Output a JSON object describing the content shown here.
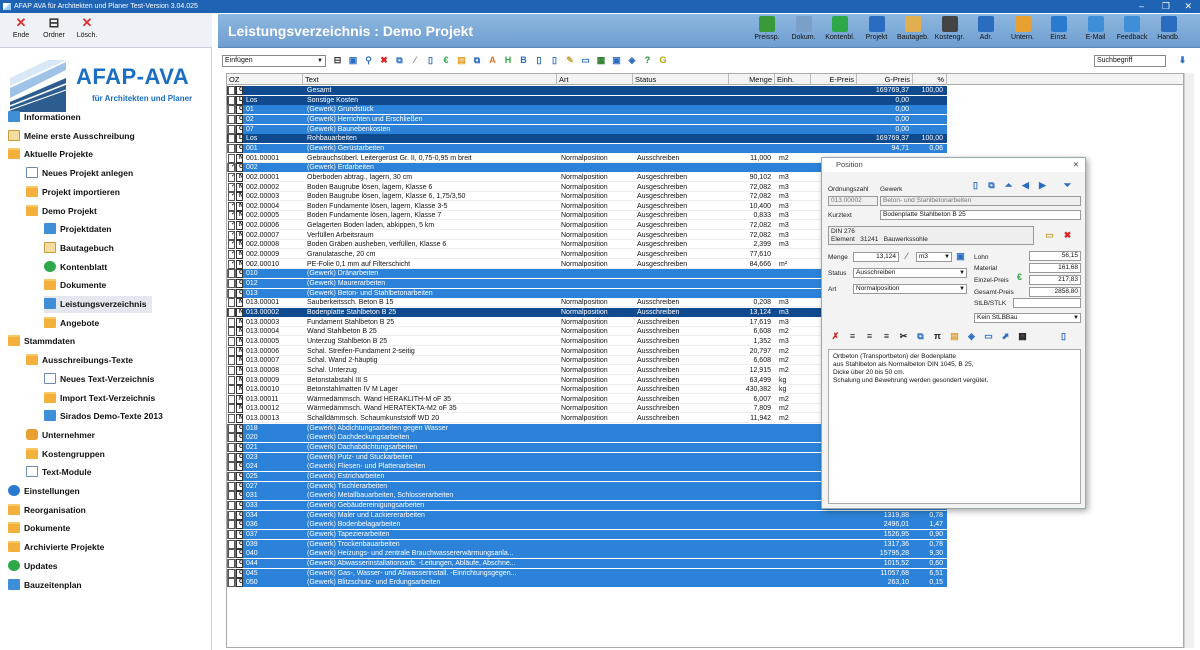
{
  "window": {
    "title": "AFAP AVA für Architekten und Planer Test-Version 3.04.025"
  },
  "left_toolbar": [
    {
      "label": "Ende",
      "icon": "close-icon",
      "color": "#d33"
    },
    {
      "label": "Ordner",
      "icon": "tree-icon",
      "color": "#333"
    },
    {
      "label": "Lösch.",
      "icon": "delete-icon",
      "color": "#d33"
    }
  ],
  "brand": {
    "name": "AFAP-AVA",
    "tagline": "für Architekten und Planer"
  },
  "nav": [
    {
      "label": "Informationen",
      "icon": "blue",
      "level": 0
    },
    {
      "label": "Meine erste Ausschreibung",
      "icon": "book",
      "level": 0
    },
    {
      "label": "Aktuelle Projekte",
      "icon": "folder",
      "level": 0
    },
    {
      "label": "Neues Projekt anlegen",
      "icon": "doc",
      "level": 1
    },
    {
      "label": "Projekt importieren",
      "icon": "folder",
      "level": 1
    },
    {
      "label": "Demo Projekt",
      "icon": "folder",
      "level": 1
    },
    {
      "label": "Projektdaten",
      "icon": "blue",
      "level": 2
    },
    {
      "label": "Bautagebuch",
      "icon": "book",
      "level": 2
    },
    {
      "label": "Kontenblatt",
      "icon": "green",
      "level": 2
    },
    {
      "label": "Dokumente",
      "icon": "folder",
      "level": 2
    },
    {
      "label": "Leistungsverzeichnis",
      "icon": "blue",
      "level": 2,
      "selected": true
    },
    {
      "label": "Angebote",
      "icon": "folder",
      "level": 2
    },
    {
      "label": "Stammdaten",
      "icon": "folder",
      "level": 0
    },
    {
      "label": "Ausschreibungs-Texte",
      "icon": "folder",
      "level": 1
    },
    {
      "label": "Neues Text-Verzeichnis",
      "icon": "doc",
      "level": 2
    },
    {
      "label": "Import Text-Verzeichnis",
      "icon": "folder",
      "level": 2
    },
    {
      "label": "Sirados Demo-Texte 2013",
      "icon": "blue",
      "level": 2
    },
    {
      "label": "Unternehmer",
      "icon": "hand",
      "level": 1
    },
    {
      "label": "Kostengruppen",
      "icon": "folder",
      "level": 1
    },
    {
      "label": "Text-Module",
      "icon": "doc",
      "level": 1
    },
    {
      "label": "Einstellungen",
      "icon": "gear",
      "level": 0
    },
    {
      "label": "Reorganisation",
      "icon": "folder",
      "level": 0
    },
    {
      "label": "Dokumente",
      "icon": "folder",
      "level": 0
    },
    {
      "label": "Archivierte Projekte",
      "icon": "folder",
      "level": 0
    },
    {
      "label": "Updates",
      "icon": "green",
      "level": 0
    },
    {
      "label": "Bauzeitenplan",
      "icon": "blue",
      "level": 0
    }
  ],
  "header": {
    "title": "Leistungsverzeichnis : Demo Projekt",
    "buttons": [
      {
        "label": "Preissp.",
        "icon": "chart-icon",
        "color": "#3a9a3a"
      },
      {
        "label": "Dokum.",
        "icon": "document-icon",
        "color": "#7aa0c8"
      },
      {
        "label": "Kontenbl.",
        "icon": "euro-icon",
        "color": "#2fa84a"
      },
      {
        "label": "Projekt",
        "icon": "building-icon",
        "color": "#2a6cc0"
      },
      {
        "label": "Bautageb.",
        "icon": "book-icon",
        "color": "#e0b050"
      },
      {
        "label": "Kostengr.",
        "icon": "tree-icon",
        "color": "#444"
      },
      {
        "label": "Adr.",
        "icon": "mail-icon",
        "color": "#2a6cc0"
      },
      {
        "label": "Untern.",
        "icon": "hand-icon",
        "color": "#e8a030"
      },
      {
        "label": "Einst.",
        "icon": "gear-icon",
        "color": "#2a7ad0"
      },
      {
        "label": "E-Mail",
        "icon": "email-icon",
        "color": "#3f8fd8"
      },
      {
        "label": "Feedback",
        "icon": "feedback-icon",
        "color": "#3f8fd8"
      },
      {
        "label": "Handb.",
        "icon": "manual-icon",
        "color": "#2a6cc0"
      }
    ]
  },
  "toolbar": {
    "insert_value": "Einfügen",
    "search_placeholder": "Suchbegriff"
  },
  "grid": {
    "columns": [
      "OZ",
      "Text",
      "Art",
      "Status",
      "Menge",
      "Einh.",
      "E-Preis",
      "G-Preis",
      "%"
    ],
    "rows": [
      {
        "t": "l",
        "tag": "G",
        "oz": "",
        "text": "Gesamt",
        "gp": "169769,37",
        "pct": "100,00"
      },
      {
        "t": "l",
        "tag": "L",
        "oz": "Los",
        "text": "Sonstige Kosten",
        "gp": "0,00"
      },
      {
        "t": "g",
        "tag": "G",
        "oz": "01",
        "text": "(Gewerk) Grundstück",
        "gp": "0,00"
      },
      {
        "t": "g",
        "tag": "G",
        "oz": "02",
        "text": "(Gewerk) Herrichten und Erschließen",
        "gp": "0,00"
      },
      {
        "t": "g",
        "tag": "G",
        "oz": "07",
        "text": "(Gewerk) Baunebenkosten",
        "gp": "0,00"
      },
      {
        "t": "l",
        "tag": "L",
        "oz": "Los",
        "text": "Rohbauarbeiten",
        "gp": "169769,37",
        "pct": "100,00"
      },
      {
        "t": "g",
        "tag": "G",
        "oz": "001",
        "text": "(Gewerk) Gerüstarbeiten",
        "gp": "94,71",
        "pct": "0,06"
      },
      {
        "t": "n",
        "tag": "N",
        "oz": "001.00001",
        "text": "Gebrauchsüberl. Leitergerüst Gr. II, 0,75-0,95 m breit",
        "art": "Normalposition",
        "st": "Ausschreiben",
        "m": "11,000",
        "e": "m2"
      },
      {
        "t": "g",
        "tag": "G",
        "chk": true,
        "oz": "002",
        "text": "(Gewerk) Erdarbeiten"
      },
      {
        "t": "n",
        "tag": "N",
        "chk": true,
        "oz": "002.00001",
        "text": "Oberboden abtrag., lagern, 30 cm",
        "art": "Normalposition",
        "st": "Ausgeschreiben",
        "m": "90,102",
        "e": "m3"
      },
      {
        "t": "n",
        "tag": "N",
        "chk": true,
        "oz": "002.00002",
        "text": "Boden Baugrube lösen, lagern, Klasse 6",
        "art": "Normalposition",
        "st": "Ausgeschreiben",
        "m": "72,082",
        "e": "m3"
      },
      {
        "t": "n",
        "tag": "N",
        "chk": true,
        "oz": "002.00003",
        "text": "Boden Baugrube lösen, lagern, Klasse 6, 1,75/3,50",
        "art": "Normalposition",
        "st": "Ausgeschreiben",
        "m": "72,082",
        "e": "m3"
      },
      {
        "t": "n",
        "tag": "N",
        "chk": true,
        "oz": "002.00004",
        "text": "Boden Fundamente lösen, lagern, Klasse 3-5",
        "art": "Normalposition",
        "st": "Ausgeschreiben",
        "m": "10,400",
        "e": "m3"
      },
      {
        "t": "n",
        "tag": "N",
        "chk": true,
        "oz": "002.00005",
        "text": "Boden Fundamente lösen, lagern, Klasse 7",
        "art": "Normalposition",
        "st": "Ausgeschreiben",
        "m": "0,833",
        "e": "m3"
      },
      {
        "t": "n",
        "tag": "N",
        "chk": true,
        "oz": "002.00006",
        "text": "Gelagerten Boden laden, abkippen, 5 km",
        "art": "Normalposition",
        "st": "Ausgeschreiben",
        "m": "72,082",
        "e": "m3"
      },
      {
        "t": "n",
        "tag": "N",
        "chk": true,
        "oz": "002.00007",
        "text": "Verfüllen Arbeitsraum",
        "art": "Normalposition",
        "st": "Ausgeschreiben",
        "m": "72,082",
        "e": "m3"
      },
      {
        "t": "n",
        "tag": "N",
        "chk": true,
        "oz": "002.00008",
        "text": "Boden Gräben ausheben, verfüllen, Klasse 6",
        "art": "Normalposition",
        "st": "Ausgeschreiben",
        "m": "2,399",
        "e": "m3"
      },
      {
        "t": "n",
        "tag": "N",
        "chk": true,
        "oz": "002.00009",
        "text": "Granulatasche, 20 cm",
        "art": "Normalposition",
        "st": "Ausgeschreiben",
        "m": "77,610",
        "e": ""
      },
      {
        "t": "n",
        "tag": "N",
        "chk": true,
        "oz": "002.00010",
        "text": "PE-Folie 0,1 mm auf Filterschicht",
        "art": "Normalposition",
        "st": "Ausgeschreiben",
        "m": "84,666",
        "e": "m²"
      },
      {
        "t": "g",
        "tag": "G",
        "oz": "010",
        "text": "(Gewerk) Dränarbeiten"
      },
      {
        "t": "g",
        "tag": "G",
        "oz": "012",
        "text": "(Gewerk) Maurerarbeiten"
      },
      {
        "t": "g",
        "tag": "G",
        "oz": "013",
        "text": "(Gewerk) Beton- und Stahlbetonarbeiten"
      },
      {
        "t": "n",
        "tag": "N",
        "oz": "013.00001",
        "text": "Sauberkeitssch. Beton B 15",
        "art": "Normalposition",
        "st": "Ausschreiben",
        "m": "0,208",
        "e": "m3"
      },
      {
        "t": "sel",
        "tag": "N",
        "oz": "013.00002",
        "text": "Bodenplatte Stahlbeton B 25",
        "art": "Normalposition",
        "st": "Ausschreiben",
        "m": "13,124",
        "e": "m3"
      },
      {
        "t": "n",
        "tag": "N",
        "oz": "013.00003",
        "text": "Fundament Stahlbeton B 25",
        "art": "Normalposition",
        "st": "Ausschreiben",
        "m": "17,619",
        "e": "m3"
      },
      {
        "t": "n",
        "tag": "N",
        "oz": "013.00004",
        "text": "Wand Stahlbeton B 25",
        "art": "Normalposition",
        "st": "Ausschreiben",
        "m": "6,608",
        "e": "m2"
      },
      {
        "t": "n",
        "tag": "N",
        "oz": "013.00005",
        "text": "Unterzug Stahlbeton B 25",
        "art": "Normalposition",
        "st": "Ausschreiben",
        "m": "1,352",
        "e": "m3"
      },
      {
        "t": "n",
        "tag": "N",
        "oz": "013.00006",
        "text": "Schal. Streifen-Fundament 2-seitig",
        "art": "Normalposition",
        "st": "Ausschreiben",
        "m": "20,797",
        "e": "m2"
      },
      {
        "t": "n",
        "tag": "N",
        "oz": "013.00007",
        "text": "Schal. Wand 2-häuptig",
        "art": "Normalposition",
        "st": "Ausschreiben",
        "m": "6,608",
        "e": "m2"
      },
      {
        "t": "n",
        "tag": "N",
        "oz": "013.00008",
        "text": "Schal. Unterzug",
        "art": "Normalposition",
        "st": "Ausschreiben",
        "m": "12,915",
        "e": "m2"
      },
      {
        "t": "n",
        "tag": "N",
        "oz": "013.00009",
        "text": "Betonstabstahl III S",
        "art": "Normalposition",
        "st": "Ausschreiben",
        "m": "63,499",
        "e": "kg"
      },
      {
        "t": "n",
        "tag": "N",
        "oz": "013.00010",
        "text": "Betonstahlmatten IV M Lager",
        "art": "Normalposition",
        "st": "Ausschreiben",
        "m": "430,382",
        "e": "kg"
      },
      {
        "t": "n",
        "tag": "N",
        "oz": "013.00011",
        "text": "Wärmedämmsch. Wand HERAKLITH-M oF 35",
        "art": "Normalposition",
        "st": "Ausschreiben",
        "m": "6,007",
        "e": "m2"
      },
      {
        "t": "n",
        "tag": "N",
        "oz": "013.00012",
        "text": "Wärmedämmsch. Wand HERATEKTA-M2 oF 35",
        "art": "Normalposition",
        "st": "Ausschreiben",
        "m": "7,809",
        "e": "m2"
      },
      {
        "t": "n",
        "tag": "N",
        "oz": "013.00013",
        "text": "Schalldämmsch. Schaumkunststoff WD 20",
        "art": "Normalposition",
        "st": "Ausschreiben",
        "m": "11,942",
        "e": "m2"
      },
      {
        "t": "g",
        "tag": "G",
        "oz": "018",
        "text": "(Gewerk) Abdichtungsarbeiten gegen Wasser"
      },
      {
        "t": "g",
        "tag": "G",
        "oz": "020",
        "text": "(Gewerk) Dachdeckungsarbeiten"
      },
      {
        "t": "g",
        "tag": "G",
        "oz": "021",
        "text": "(Gewerk) Dachabdichtungsarbeiten"
      },
      {
        "t": "g",
        "tag": "G",
        "oz": "023",
        "text": "(Gewerk) Putz- und Stuckarbeiten"
      },
      {
        "t": "g",
        "tag": "G",
        "oz": "024",
        "text": "(Gewerk) Fliesen- und Plattenarbeiten"
      },
      {
        "t": "g",
        "tag": "G",
        "oz": "025",
        "text": "(Gewerk) Estricharbeiten",
        "gp": "7364,76",
        "pct": "4,34"
      },
      {
        "t": "g",
        "tag": "G",
        "oz": "027",
        "text": "(Gewerk) Tischlerarbeiten",
        "gp": "9407,31",
        "pct": "5,54"
      },
      {
        "t": "g",
        "tag": "G",
        "oz": "031",
        "text": "(Gewerk) Metallbauarbeiten, Schlosserarbeiten",
        "gp": "1048,72",
        "pct": "0,62"
      },
      {
        "t": "g",
        "tag": "G",
        "oz": "033",
        "text": "(Gewerk) Gebäudereinigungsarbeiten",
        "gp": "5,82",
        "pct": "0,00"
      },
      {
        "t": "g",
        "tag": "G",
        "oz": "034",
        "text": "(Gewerk) Maler und Lackiererarbeiten",
        "gp": "1319,88",
        "pct": "0,78"
      },
      {
        "t": "g",
        "tag": "G",
        "oz": "036",
        "text": "(Gewerk) Bodenbelagarbeiten",
        "gp": "2496,01",
        "pct": "1,47"
      },
      {
        "t": "g",
        "tag": "G",
        "oz": "037",
        "text": "(Gewerk) Tapezierarbeiten",
        "gp": "1526,95",
        "pct": "0,90"
      },
      {
        "t": "g",
        "tag": "G",
        "oz": "039",
        "text": "(Gewerk) Trockenbauarbeiten",
        "gp": "1317,36",
        "pct": "0,78"
      },
      {
        "t": "g",
        "tag": "G",
        "oz": "040",
        "text": "(Gewerk) Heizungs- und zentrale Brauchwassererwärmungsanla...",
        "gp": "15795,28",
        "pct": "9,30"
      },
      {
        "t": "g",
        "tag": "G",
        "oz": "044",
        "text": "(Gewerk) Abwasserinstallationsarb. -Leitungen, Abläufe, Abschne...",
        "gp": "1015,52",
        "pct": "0,60"
      },
      {
        "t": "g",
        "tag": "G",
        "oz": "045",
        "text": "(Gewerk) Gas-, Wasser- und Abwasserinstall. -Einrichtungsgegen...",
        "gp": "11057,68",
        "pct": "6,51"
      },
      {
        "t": "g",
        "tag": "G",
        "oz": "050",
        "text": "(Gewerk) Blitzschutz- und Erdungsarbeiten",
        "gp": "263,10",
        "pct": "0,15"
      }
    ]
  },
  "dialog": {
    "title": "Position",
    "lbl_oz": "Ordnungszahl",
    "lbl_gewerk": "Gewerk",
    "oz": "013.00002",
    "gewerk": "Beton- und Stahlbetonarbeiten",
    "lbl_kurztext": "Kurztext",
    "kurztext": "Bodenplatte Stahlbeton B 25",
    "din": "DIN 276",
    "element_lbl": "Element",
    "element_no": "31241",
    "element_name": "Bauwerkssohle",
    "lbl_menge": "Menge",
    "menge": "13,124",
    "einheit": "m3",
    "lbl_status": "Status",
    "status": "Ausschreiben",
    "lbl_art": "Art",
    "art": "Normalposition",
    "lbl_lohn": "Lohn",
    "lohn": "56,15",
    "lbl_material": "Material",
    "material": "161,68",
    "lbl_ep": "Einzel-Preis",
    "ep": "217,83",
    "lbl_gp": "Gesamt-Preis",
    "gp": "2858,80",
    "lbl_stlb": "StLB/STLK",
    "stlb": "Kein StLBBau",
    "longtext": [
      "Ortbeton (Transportbeton) der Bodenplatte",
      "aus Stahlbeton als Normalbeton DIN 1045, B 25,",
      "Dicke über 20 bis 50 cm.",
      "Schalung und Bewehrung werden gesondert vergütet."
    ]
  }
}
